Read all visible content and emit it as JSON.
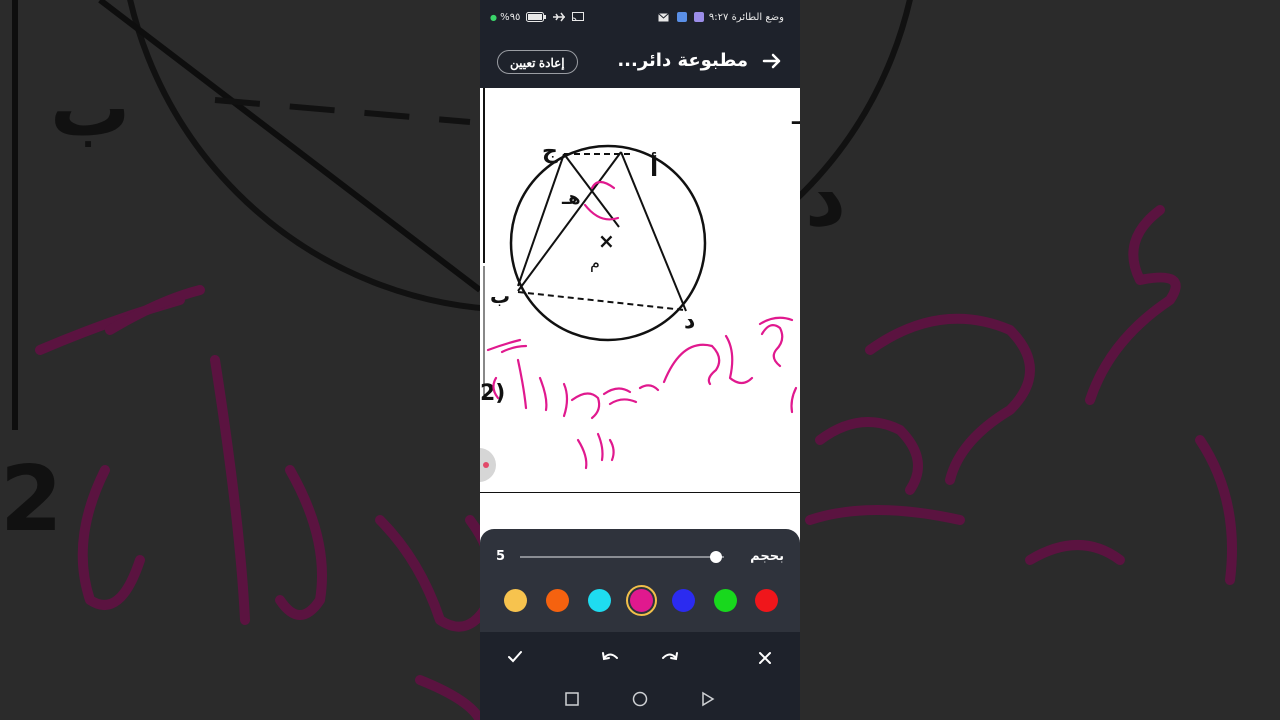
{
  "status_bar": {
    "airplane_mode_text": "وضع الطائرة",
    "time": "٩:٢٧",
    "battery": "%٩٥"
  },
  "header": {
    "title": "مطبوعة دائر...",
    "reset_label": "إعادة تعيين",
    "back_icon": "arrow-right-icon"
  },
  "canvas": {
    "formula": "× ب هـ = ج هـ × د هـ",
    "points": {
      "a": "أ",
      "c": "ج",
      "e": "هـ",
      "m": "م",
      "b": "ب",
      "d": "د"
    },
    "marker": "×",
    "question_number": "2)",
    "ink_color": "#e0198e"
  },
  "brush_panel": {
    "size_label": "بحجم",
    "size_value": "5",
    "size_level_fraction": 0.96,
    "colors": [
      "#f7c34e",
      "#f5620f",
      "#1fdcf0",
      "#e0198e",
      "#2b2bf0",
      "#18d81d",
      "#f0161b"
    ],
    "selected_color": "#e0198e"
  },
  "action_bar": {
    "confirm_icon": "check-icon",
    "undo_icon": "undo-icon",
    "redo_icon": "redo-icon",
    "close_icon": "close-icon"
  },
  "nav_bar": {
    "recent_icon": "square-icon",
    "home_icon": "circle-icon",
    "back_icon": "triangle-icon"
  }
}
